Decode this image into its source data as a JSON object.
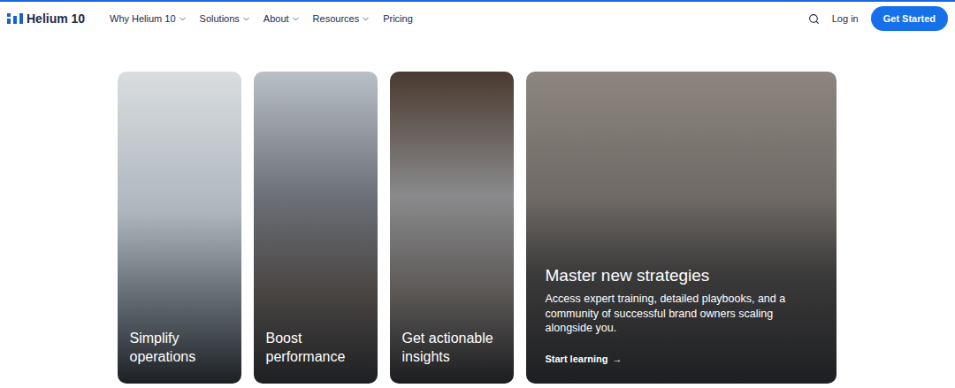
{
  "nav": {
    "logo": "Helium 10",
    "links": [
      {
        "label": "Why Helium 10",
        "dropdown": true
      },
      {
        "label": "Solutions",
        "dropdown": true
      },
      {
        "label": "About",
        "dropdown": true
      },
      {
        "label": "Resources",
        "dropdown": true
      },
      {
        "label": "Pricing",
        "dropdown": false
      }
    ],
    "login": "Log in",
    "cta": "Get Started"
  },
  "cards": [
    {
      "title": "Simplify operations",
      "expanded": false,
      "description": "",
      "link": "",
      "arrow": ""
    },
    {
      "title": "Boost performance",
      "expanded": false,
      "description": "",
      "link": "",
      "arrow": ""
    },
    {
      "title": "Get actionable insights",
      "expanded": false,
      "description": "",
      "link": "",
      "arrow": ""
    },
    {
      "title": "Master new strategies",
      "expanded": true,
      "description": "Access expert training, detailed playbooks, and a community of successful brand owners scaling alongside you.",
      "link": "Start learning",
      "arrow": "→"
    }
  ]
}
